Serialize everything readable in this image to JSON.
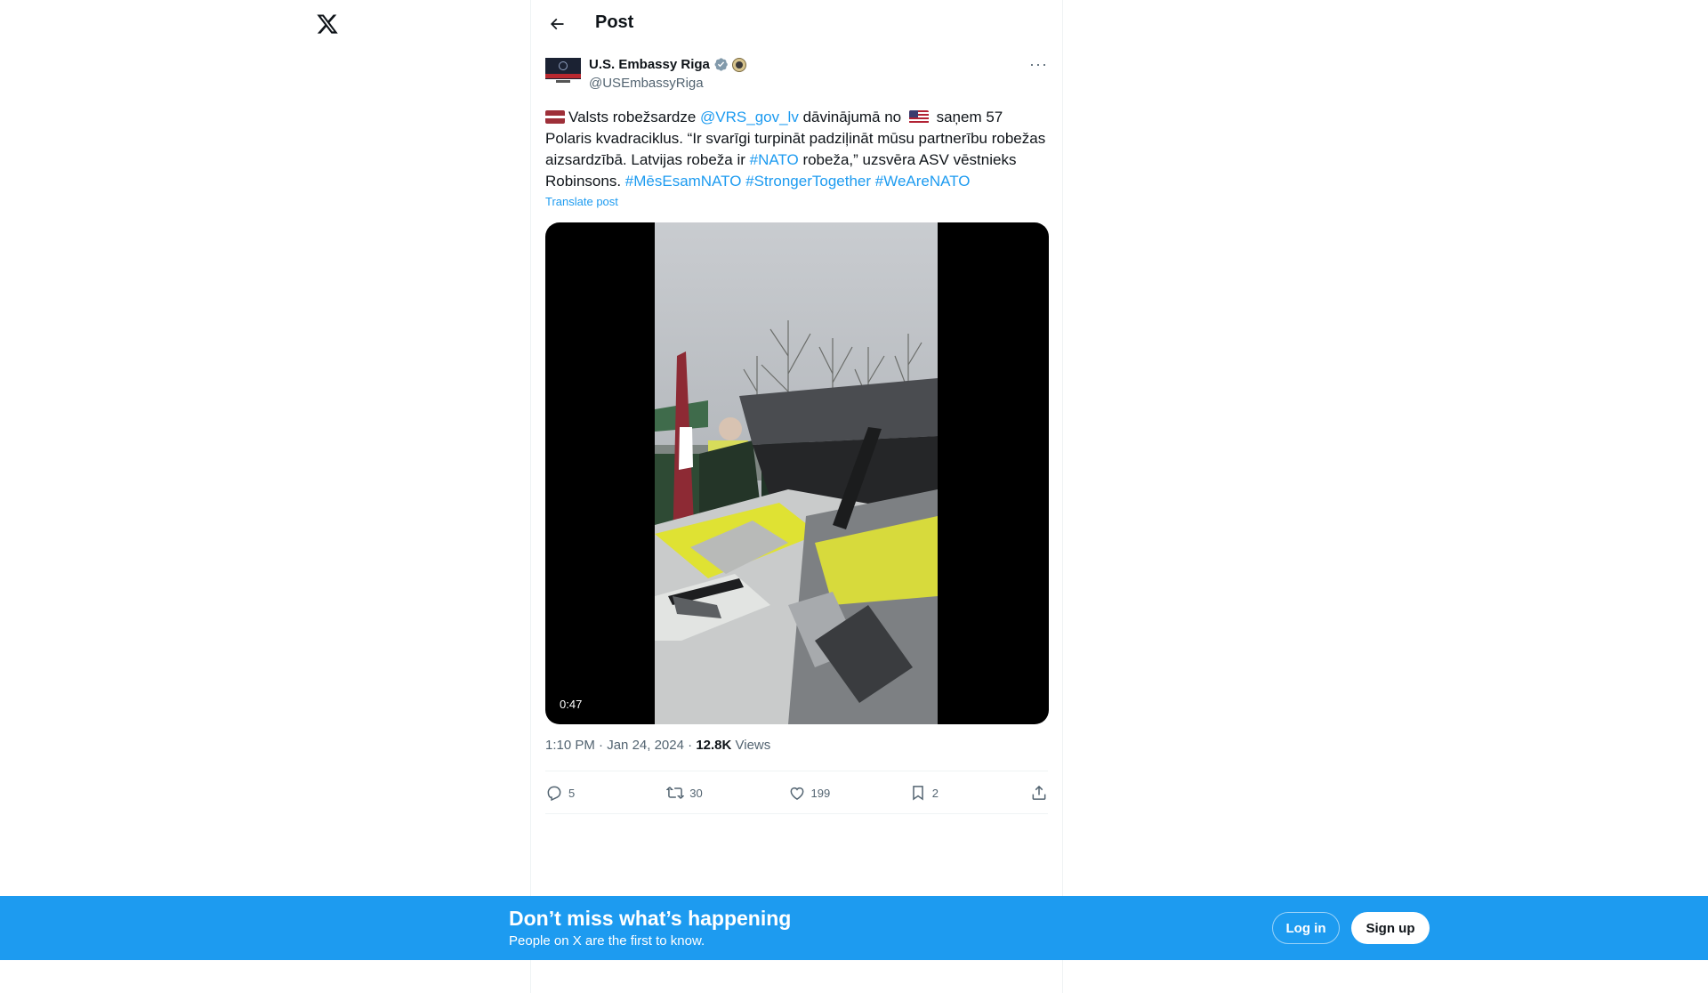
{
  "logo": {
    "icon": "x-logo-icon"
  },
  "header": {
    "title": "Post",
    "back_icon": "arrow-left-icon"
  },
  "tweet": {
    "author": {
      "name": "U.S. Embassy Riga",
      "handle": "@USEmbassyRiga",
      "verified_icon": "verified-badge-icon",
      "affiliation_icon": "government-seal-icon"
    },
    "text_parts": {
      "p1": "Valsts robežsardze ",
      "mention": "@VRS_gov_lv",
      "p2": " dāvinājumā no ",
      "p3": " saņem 57 Polaris kvadraciklus. “Ir svarīgi turpināt padziļināt mūsu partnerību robežas aizsardzībā. Latvijas robeža ir ",
      "tag_nato": "#NATO",
      "p4": " robeža,” uzsvēra ASV vēstnieks Robinsons. ",
      "tag1": "#MēsEsamNATO",
      "tag2": "#StrongerTogether",
      "tag3": "#WeAreNATO"
    },
    "translate_label": "Translate post",
    "video_duration": "0:47",
    "time": "1:10 PM",
    "date": "Jan 24, 2024",
    "views_count": "12.8K",
    "views_label": "Views",
    "replies": "5",
    "reposts": "30",
    "likes": "199",
    "bookmarks": "2"
  },
  "banner": {
    "title": "Don’t miss what’s happening",
    "subtitle": "People on X are the first to know.",
    "login_label": "Log in",
    "signup_label": "Sign up"
  },
  "colors": {
    "accent": "#1d9bf0",
    "text": "#0f1419",
    "muted": "#536471"
  }
}
